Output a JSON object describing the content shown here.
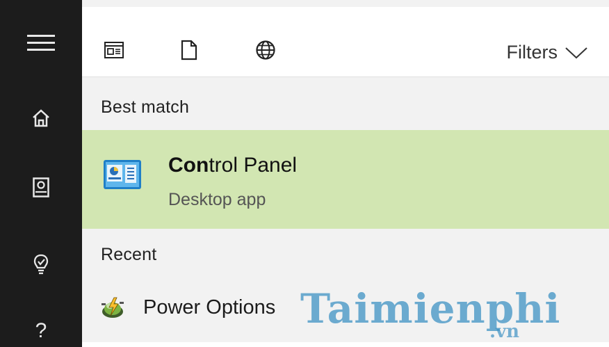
{
  "sidebar": {
    "items": [
      {
        "icon": "hamburger-menu-icon"
      },
      {
        "icon": "home-icon"
      },
      {
        "icon": "notebook-icon"
      },
      {
        "icon": "lightbulb-icon"
      },
      {
        "icon": "help-icon",
        "glyph": "?"
      }
    ]
  },
  "toolbar": {
    "icons": [
      "apps-filter-icon",
      "documents-filter-icon",
      "web-filter-icon"
    ],
    "filters_label": "Filters"
  },
  "best_match": {
    "heading": "Best match",
    "item": {
      "title_bold": "Con",
      "title_rest": "trol Panel",
      "subtitle": "Desktop app",
      "icon": "control-panel-icon"
    }
  },
  "recent": {
    "heading": "Recent",
    "items": [
      {
        "label": "Power Options",
        "icon": "power-options-icon"
      }
    ]
  },
  "watermark": {
    "main": "Taimienphi",
    "sub": ".vn"
  },
  "colors": {
    "sidebar_bg": "#1c1c1c",
    "panel_bg": "#f2f2f2",
    "highlight_bg": "#d2e6b2",
    "watermark": "#3f92c4"
  }
}
